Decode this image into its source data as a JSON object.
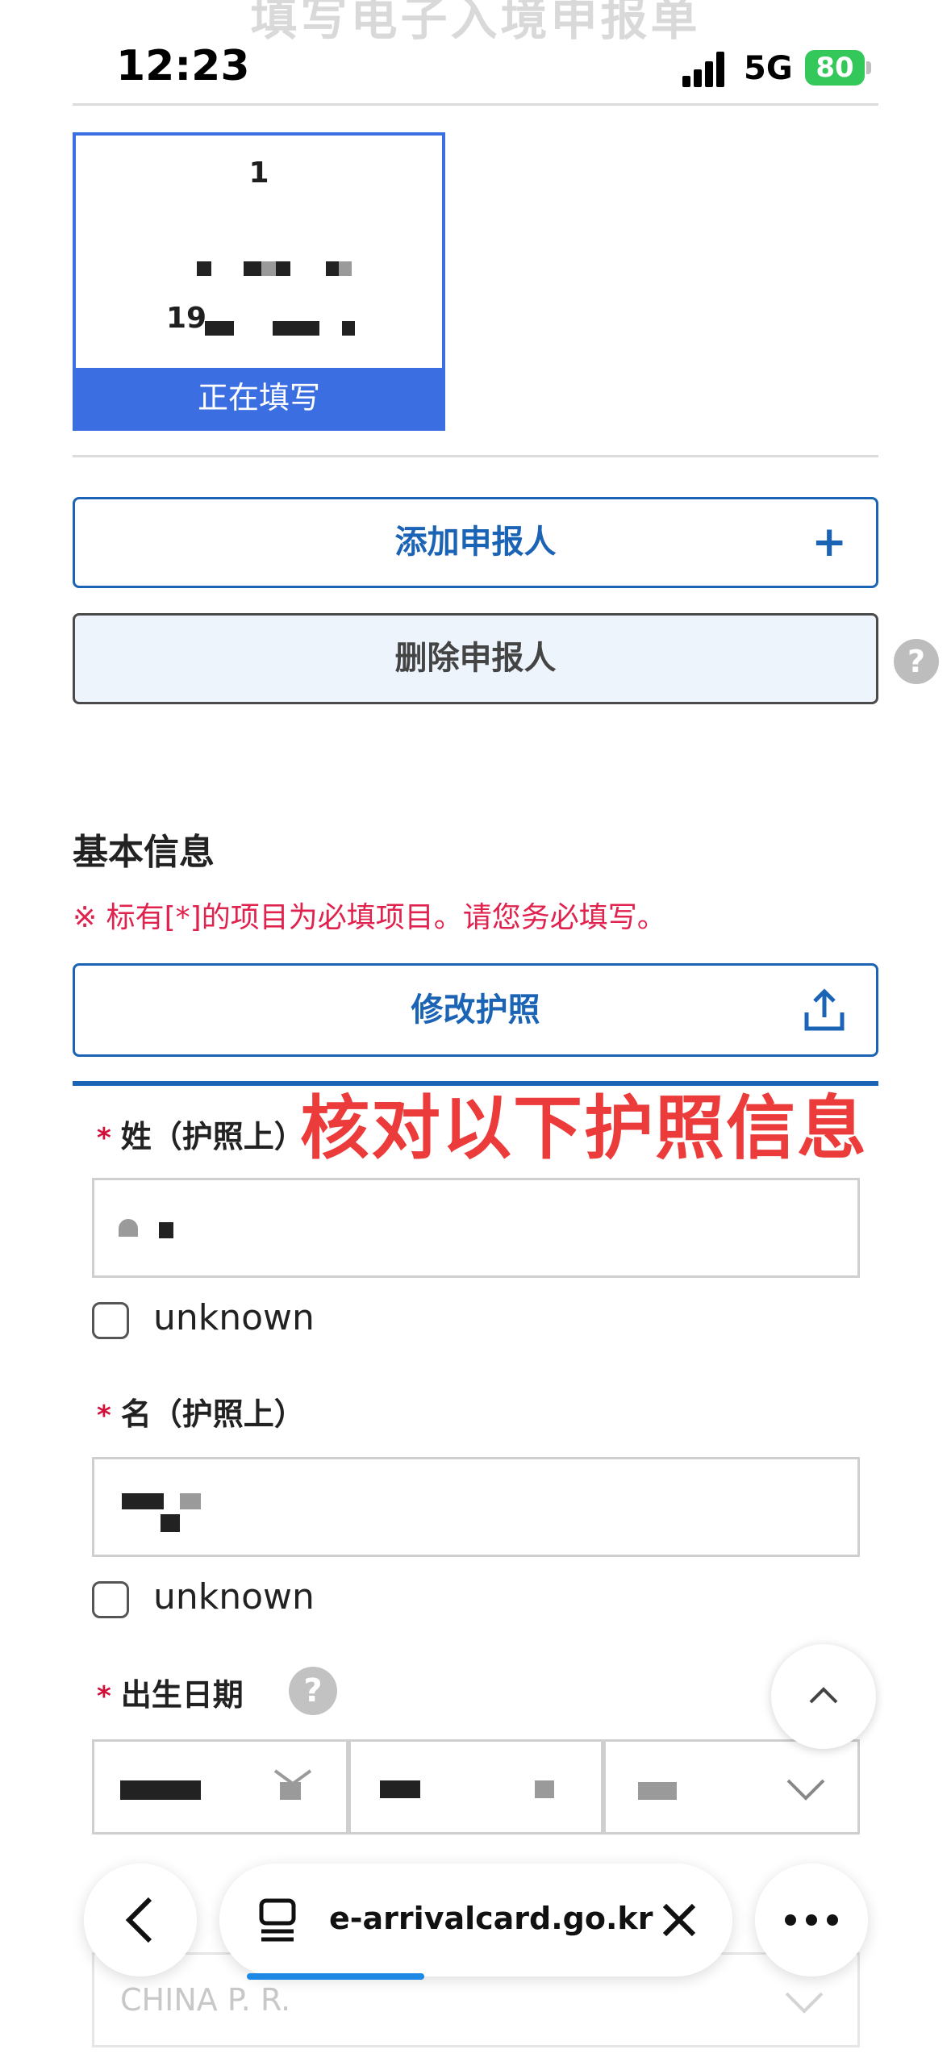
{
  "page": {
    "ghost_title": "填写电子入境申报单"
  },
  "status_bar": {
    "time": "12:23",
    "network": "5G",
    "battery": "80"
  },
  "applicant_card": {
    "number": "1",
    "dob_prefix": "19",
    "status": "正在填写"
  },
  "buttons": {
    "add_applicant": "添加申报人",
    "delete_applicant": "删除申报人",
    "modify_passport": "修改护照"
  },
  "section": {
    "title": "基本信息",
    "notice": "※ 标有[*]的项目为必填项目。请您务必填写。"
  },
  "overlay": {
    "text": "核对以下护照信息"
  },
  "fields": {
    "required_mark": "*",
    "surname": {
      "label": "姓（护照上）",
      "unknown_label": "unknown"
    },
    "given_name": {
      "label": "名（护照上）",
      "unknown_label": "unknown"
    },
    "birth_date": {
      "label": "出生日期"
    },
    "nationality": {
      "value": "CHINA P. R."
    }
  },
  "browser": {
    "url": "e-arrivalcard.go.kr"
  },
  "icons": {
    "plus": "plus-icon",
    "upload": "upload-icon",
    "help": "question-mark-icon",
    "chevron": "chevron-down-icon",
    "back": "chevron-left-icon",
    "close": "close-icon",
    "more": "more-dots-icon",
    "tabs": "tabs-icon"
  },
  "colors": {
    "primary": "#1a63b5",
    "card_accent": "#3b6ee0",
    "required": "#d0103a",
    "annotation": "#ec3b3b"
  }
}
